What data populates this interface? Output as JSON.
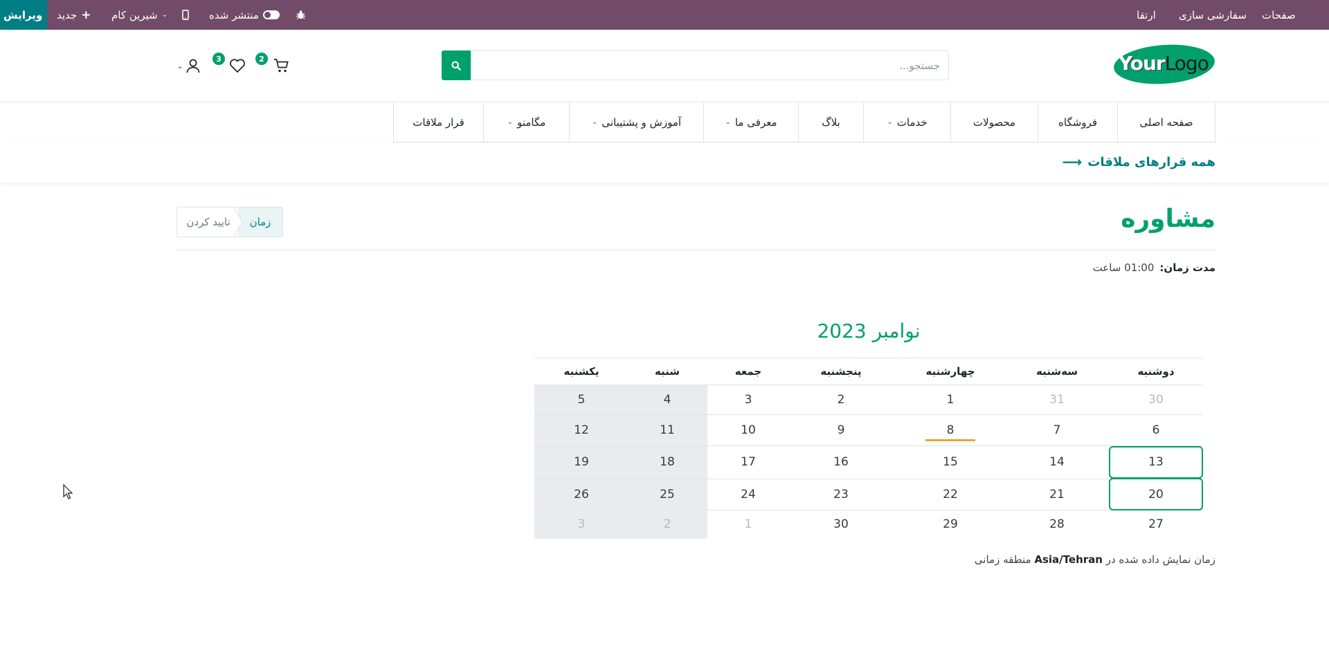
{
  "admin_bar": {
    "edit_label": "ویرایش",
    "new_label": "جدید",
    "website_label": "شیرین کام",
    "published_label": "منتشر شده",
    "pages_label": "صفحات",
    "customize_label": "سفارشی سازی",
    "upgrade_label": "ارتقا",
    "bar_color": "#714b67"
  },
  "header": {
    "logo_text_1": "Your",
    "logo_text_2": "Logo",
    "search_placeholder": "جستجو...",
    "cart_count": "2",
    "wishlist_count": "3"
  },
  "menu": {
    "items": [
      {
        "label": "صفحه اصلی"
      },
      {
        "label": "فروشگاه"
      },
      {
        "label": "محصولات"
      },
      {
        "label": "خدمات"
      },
      {
        "label": "بلاگ"
      },
      {
        "label": "معرفی ما"
      },
      {
        "label": "آموزش و پشتیبانی"
      },
      {
        "label": "مگامنو"
      },
      {
        "label": "قرار ملاقات"
      }
    ]
  },
  "back_link": "همه قرارهای ملاقات",
  "appointment": {
    "title": "مشاوره",
    "steps": {
      "active": "زمان",
      "next": "تایید کردن"
    },
    "duration_label": "مدت زمان:",
    "duration_value": "01:00 ساعت"
  },
  "calendar": {
    "month": "نوامبر 2023",
    "weekdays": [
      "دوشنبه",
      "سه‌شنبه",
      "چهارشنبه",
      "پنجشنبه",
      "جمعه",
      "شنبه",
      "یکشنبه"
    ],
    "weeks": [
      [
        "30",
        "31",
        "1",
        "2",
        "3",
        "4",
        "5"
      ],
      [
        "6",
        "7",
        "8",
        "9",
        "10",
        "11",
        "12"
      ],
      [
        "13",
        "14",
        "15",
        "16",
        "17",
        "18",
        "19"
      ],
      [
        "20",
        "21",
        "22",
        "23",
        "24",
        "25",
        "26"
      ],
      [
        "27",
        "28",
        "29",
        "30",
        "1",
        "2",
        "3"
      ]
    ],
    "today": "8",
    "available_days": [
      "13",
      "20"
    ],
    "accent_color": "#00a06c",
    "today_color": "#f0a035"
  },
  "timezone": {
    "prefix": "زمان نمایش داده شده در",
    "zone": "Asia/Tehran",
    "suffix": "منطقه زمانی"
  }
}
